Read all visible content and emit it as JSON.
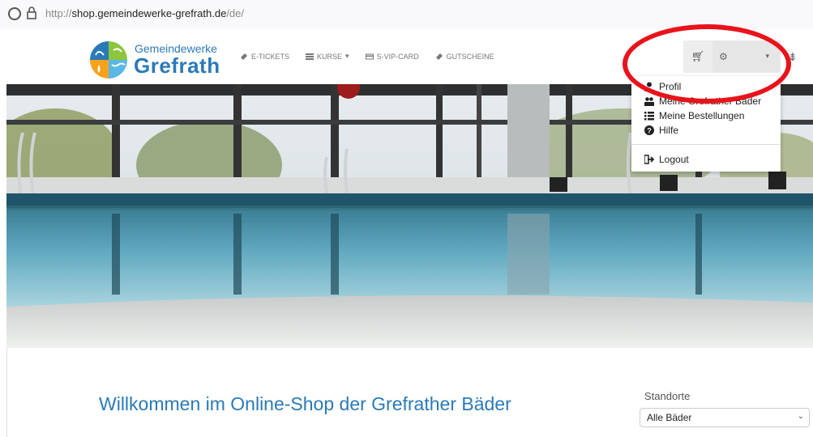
{
  "browser": {
    "url_prefix": "http://",
    "url_host": "shop.gemeindewerke-grefrath.de",
    "url_path": "/de/"
  },
  "logo": {
    "top": "Gemeindewerke",
    "main": "Grefrath"
  },
  "nav": {
    "items": [
      {
        "label": "E-TICKETS",
        "icon": "ticket-icon"
      },
      {
        "label": "KURSE",
        "icon": "list-icon"
      },
      {
        "label": "S-VIP-CARD",
        "icon": "card-icon"
      },
      {
        "label": "GUTSCHEINE",
        "icon": "tag-icon"
      }
    ]
  },
  "user_menu": {
    "items": [
      {
        "label": "Profil",
        "icon": "user-icon"
      },
      {
        "label": "Meine Grefrather Bäder",
        "icon": "users-icon"
      },
      {
        "label": "Meine Bestellungen",
        "icon": "list-icon"
      },
      {
        "label": "Hilfe",
        "icon": "question-icon"
      },
      {
        "label": "Logout",
        "icon": "logout-icon"
      }
    ]
  },
  "main": {
    "welcome": "Willkommen im Online-Shop der Grefrather Bäder",
    "standorte_label": "Standorte",
    "standorte_value": "Alle Bäder"
  },
  "colors": {
    "brand_blue": "#2a7ab8",
    "highlight_red": "#e8131b"
  }
}
